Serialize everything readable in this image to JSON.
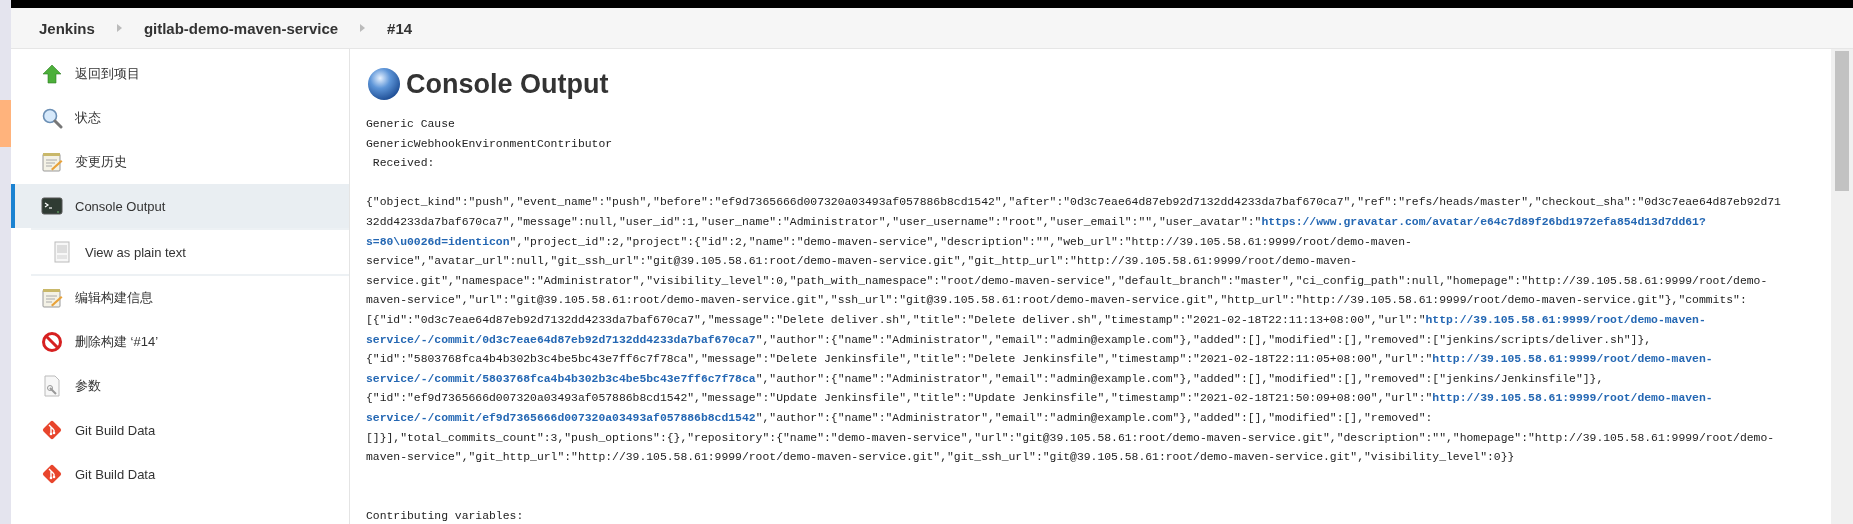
{
  "breadcrumbs": [
    {
      "label": "Jenkins"
    },
    {
      "label": "gitlab-demo-maven-service"
    },
    {
      "label": "#14"
    }
  ],
  "sidebar": {
    "items": [
      {
        "kind": "back",
        "label": "返回到项目",
        "selected": false
      },
      {
        "kind": "status",
        "label": "状态",
        "selected": false
      },
      {
        "kind": "changes",
        "label": "变更历史",
        "selected": false
      },
      {
        "kind": "console",
        "label": "Console Output",
        "selected": true,
        "children": [
          {
            "kind": "plain-text",
            "label": "View as plain text",
            "selected": false
          }
        ]
      },
      {
        "kind": "edit",
        "label": "编辑构建信息",
        "selected": false
      },
      {
        "kind": "delete",
        "label": "删除构建 ‘#14’",
        "selected": false
      },
      {
        "kind": "parameters",
        "label": "参数",
        "selected": false
      },
      {
        "kind": "git",
        "label": "Git Build Data",
        "selected": false
      },
      {
        "kind": "git",
        "label": "Git Build Data",
        "selected": false
      }
    ]
  },
  "main": {
    "title": "Console Output",
    "preamble": [
      "Generic Cause",
      "GenericWebhookEnvironmentContributor",
      " Received:"
    ],
    "payload": [
      [
        {
          "text": "{\"object_kind\":\"push\",\"event_name\":\"push\",\"before\":\"ef9d7365666d007320a03493af057886b8cd1542\",\"after\":\"0d3c7eae64d87eb92d7132dd4233da7baf670ca7\",\"ref\":\"refs/heads/master\",\"checkout_sha\":\"0d3c7eae64d87eb92d71",
          "link": false
        }
      ],
      [
        {
          "text": "32dd4233da7baf670ca7\",\"message\":null,\"user_id\":1,\"user_name\":\"Administrator\",\"user_username\":\"root\",\"user_email\":\"\",\"user_avatar\":\"",
          "link": false
        },
        {
          "text": "https://www.gravatar.com/avatar/e64c7d89f26bd1972efa854d13d7dd61?",
          "link": true
        }
      ],
      [
        {
          "text": "s=80\\u0026d=identicon",
          "link": true
        },
        {
          "text": "\",\"project_id\":2,\"project\":{\"id\":2,\"name\":\"demo-maven-service\",\"description\":\"\",\"web_url\":\"http://39.105.58.61:9999/root/demo-maven-",
          "link": false
        }
      ],
      [
        {
          "text": "service\",\"avatar_url\":null,\"git_ssh_url\":\"git@39.105.58.61:root/demo-maven-service.git\",\"git_http_url\":\"http://39.105.58.61:9999/root/demo-maven-",
          "link": false
        }
      ],
      [
        {
          "text": "service.git\",\"namespace\":\"Administrator\",\"visibility_level\":0,\"path_with_namespace\":\"root/demo-maven-service\",\"default_branch\":\"master\",\"ci_config_path\":null,\"homepage\":\"http://39.105.58.61:9999/root/demo-",
          "link": false
        }
      ],
      [
        {
          "text": "maven-service\",\"url\":\"git@39.105.58.61:root/demo-maven-service.git\",\"ssh_url\":\"git@39.105.58.61:root/demo-maven-service.git\",\"http_url\":\"http://39.105.58.61:9999/root/demo-maven-service.git\"},\"commits\":",
          "link": false
        }
      ],
      [
        {
          "text": "[{\"id\":\"0d3c7eae64d87eb92d7132dd4233da7baf670ca7\",\"message\":\"Delete deliver.sh\",\"title\":\"Delete deliver.sh\",\"timestamp\":\"2021-02-18T22:11:13+08:00\",\"url\":\"",
          "link": false
        },
        {
          "text": "http://39.105.58.61:9999/root/demo-maven-",
          "link": true
        }
      ],
      [
        {
          "text": "service/-/commit/0d3c7eae64d87eb92d7132dd4233da7baf670ca7",
          "link": true
        },
        {
          "text": "\",\"author\":{\"name\":\"Administrator\",\"email\":\"admin@example.com\"},\"added\":[],\"modified\":[],\"removed\":[\"jenkins/scripts/deliver.sh\"]},",
          "link": false
        }
      ],
      [
        {
          "text": "{\"id\":\"5803768fca4b4b302b3c4be5bc43e7ff6c7f78ca\",\"message\":\"Delete Jenkinsfile\",\"title\":\"Delete Jenkinsfile\",\"timestamp\":\"2021-02-18T22:11:05+08:00\",\"url\":\"",
          "link": false
        },
        {
          "text": "http://39.105.58.61:9999/root/demo-maven-",
          "link": true
        }
      ],
      [
        {
          "text": "service/-/commit/5803768fca4b4b302b3c4be5bc43e7ff6c7f78ca",
          "link": true
        },
        {
          "text": "\",\"author\":{\"name\":\"Administrator\",\"email\":\"admin@example.com\"},\"added\":[],\"modified\":[],\"removed\":[\"jenkins/Jenkinsfile\"]},",
          "link": false
        }
      ],
      [
        {
          "text": "{\"id\":\"ef9d7365666d007320a03493af057886b8cd1542\",\"message\":\"Update Jenkinsfile\",\"title\":\"Update Jenkinsfile\",\"timestamp\":\"2021-02-18T21:50:09+08:00\",\"url\":\"",
          "link": false
        },
        {
          "text": "http://39.105.58.61:9999/root/demo-maven-",
          "link": true
        }
      ],
      [
        {
          "text": "service/-/commit/ef9d7365666d007320a03493af057886b8cd1542",
          "link": true
        },
        {
          "text": "\",\"author\":{\"name\":\"Administrator\",\"email\":\"admin@example.com\"},\"added\":[],\"modified\":[],\"removed\":",
          "link": false
        }
      ],
      [
        {
          "text": "[]}],\"total_commits_count\":3,\"push_options\":{},\"repository\":{\"name\":\"demo-maven-service\",\"url\":\"git@39.105.58.61:root/demo-maven-service.git\",\"description\":\"\",\"homepage\":\"http://39.105.58.61:9999/root/demo-",
          "link": false
        }
      ],
      [
        {
          "text": "maven-service\",\"git_http_url\":\"http://39.105.58.61:9999/root/demo-maven-service.git\",\"git_ssh_url\":\"git@39.105.58.61:root/demo-maven-service.git\",\"visibility_level\":0}}",
          "link": false
        }
      ]
    ],
    "footer": [
      "Contributing variables:"
    ]
  }
}
